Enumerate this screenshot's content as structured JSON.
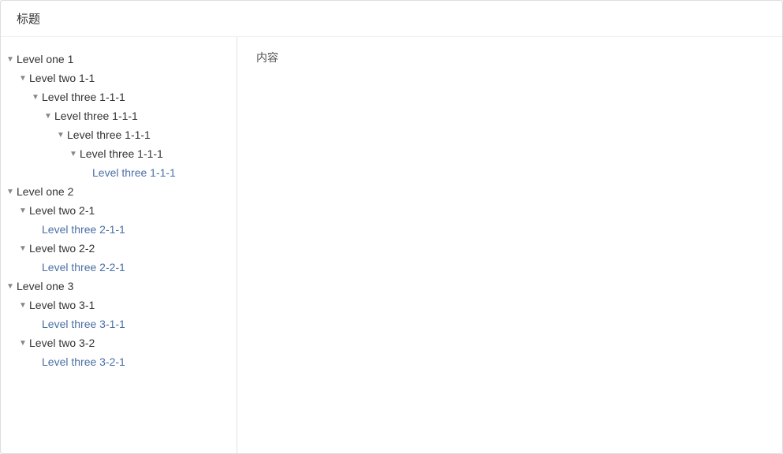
{
  "header": {
    "title": "标题"
  },
  "content": {
    "text": "内容"
  },
  "tree": [
    {
      "id": "one1",
      "label": "Level one 1",
      "indent": 0,
      "arrow": "down",
      "leaf": false
    },
    {
      "id": "two1-1",
      "label": "Level two 1-1",
      "indent": 1,
      "arrow": "down",
      "leaf": false
    },
    {
      "id": "three1-1-1a",
      "label": "Level three 1-1-1",
      "indent": 2,
      "arrow": "down",
      "leaf": false
    },
    {
      "id": "three1-1-1b",
      "label": "Level three 1-1-1",
      "indent": 3,
      "arrow": "down",
      "leaf": false
    },
    {
      "id": "three1-1-1c",
      "label": "Level three 1-1-1",
      "indent": 4,
      "arrow": "down",
      "leaf": false
    },
    {
      "id": "three1-1-1d",
      "label": "Level three 1-1-1",
      "indent": 5,
      "arrow": "down",
      "leaf": false
    },
    {
      "id": "three1-1-1e",
      "label": "Level three 1-1-1",
      "indent": 6,
      "arrow": "empty",
      "leaf": true
    },
    {
      "id": "one2",
      "label": "Level one 2",
      "indent": 0,
      "arrow": "down",
      "leaf": false
    },
    {
      "id": "two2-1",
      "label": "Level two 2-1",
      "indent": 1,
      "arrow": "down",
      "leaf": false
    },
    {
      "id": "three2-1-1",
      "label": "Level three 2-1-1",
      "indent": 2,
      "arrow": "empty",
      "leaf": true
    },
    {
      "id": "two2-2",
      "label": "Level two 2-2",
      "indent": 1,
      "arrow": "down",
      "leaf": false
    },
    {
      "id": "three2-2-1",
      "label": "Level three 2-2-1",
      "indent": 2,
      "arrow": "empty",
      "leaf": true
    },
    {
      "id": "one3",
      "label": "Level one 3",
      "indent": 0,
      "arrow": "down",
      "leaf": false
    },
    {
      "id": "two3-1",
      "label": "Level two 3-1",
      "indent": 1,
      "arrow": "down",
      "leaf": false
    },
    {
      "id": "three3-1-1",
      "label": "Level three 3-1-1",
      "indent": 2,
      "arrow": "empty",
      "leaf": true
    },
    {
      "id": "two3-2",
      "label": "Level two 3-2",
      "indent": 1,
      "arrow": "down",
      "leaf": false
    },
    {
      "id": "three3-2-1",
      "label": "Level three 3-2-1",
      "indent": 2,
      "arrow": "empty",
      "leaf": true
    }
  ]
}
